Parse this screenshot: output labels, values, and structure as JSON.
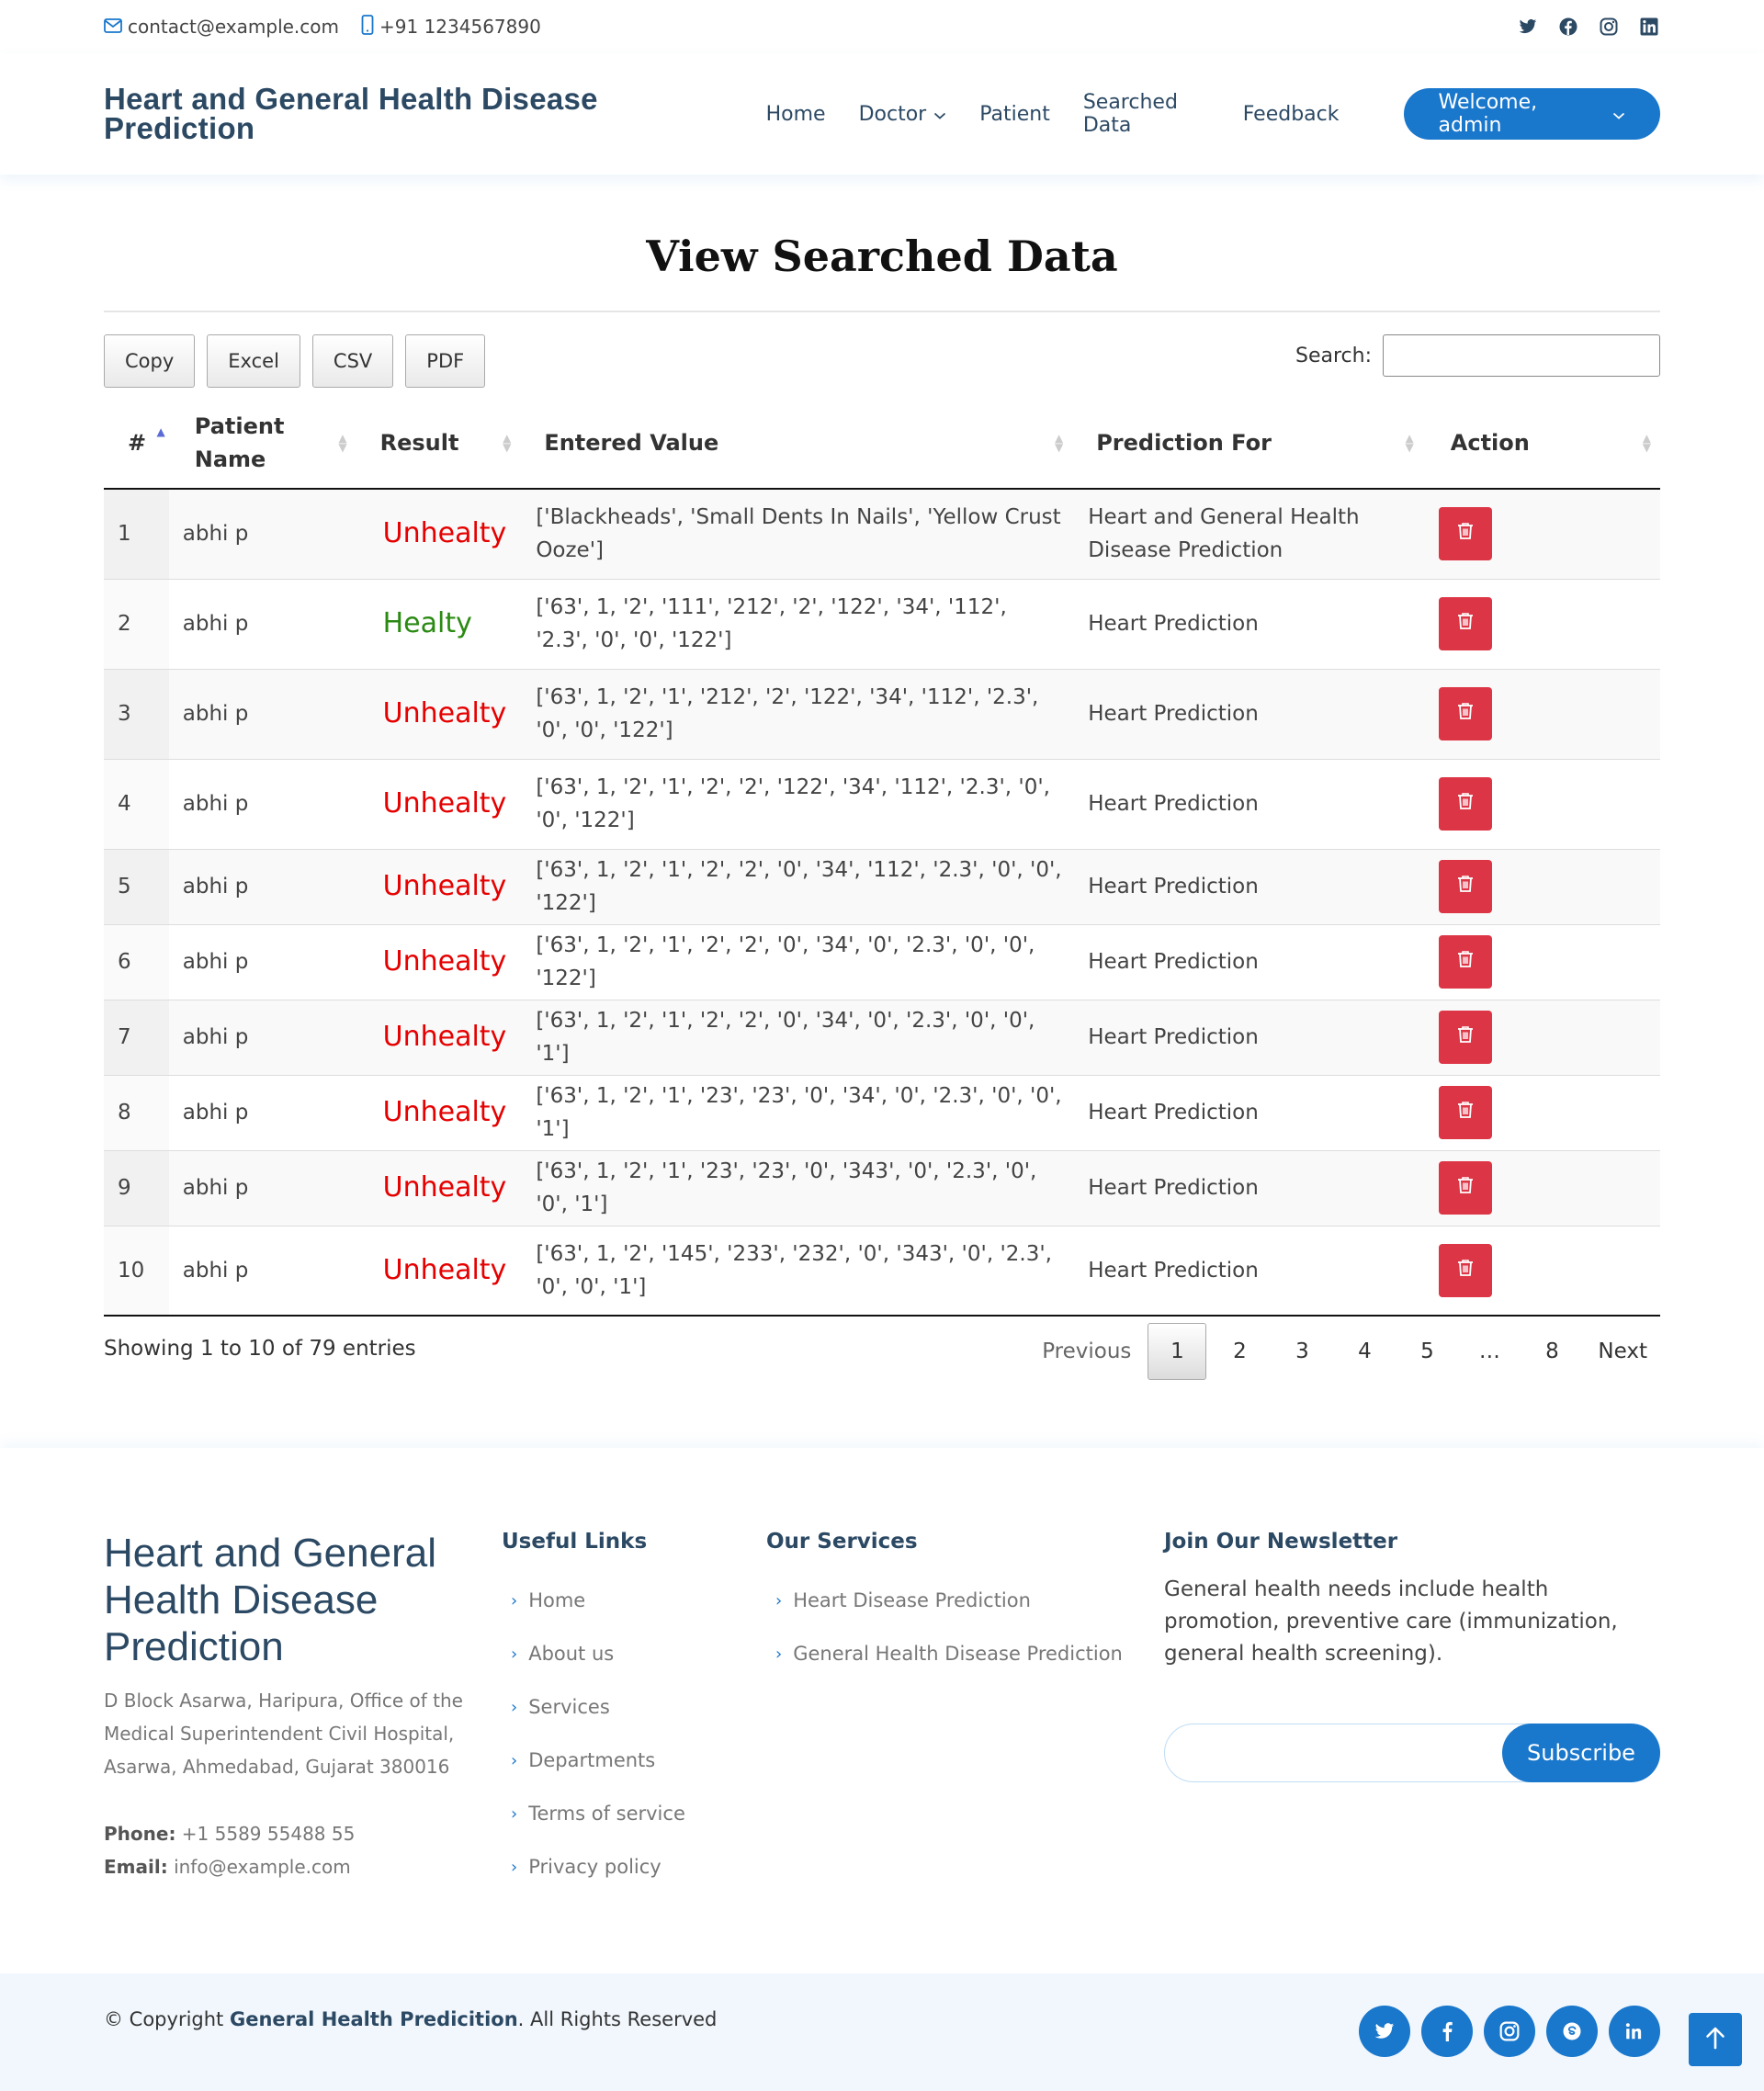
{
  "topbar": {
    "email": "contact@example.com",
    "phone": "+91 1234567890",
    "socials": [
      "twitter-icon",
      "facebook-icon",
      "instagram-icon",
      "linkedin-icon"
    ]
  },
  "header": {
    "logo": "Heart and General Health Disease Prediction",
    "nav": {
      "home": "Home",
      "doctor": "Doctor",
      "patient": "Patient",
      "searched": "Searched Data",
      "feedback": "Feedback"
    },
    "welcome": "Welcome, admin"
  },
  "main": {
    "title": "View Searched Data",
    "buttons": {
      "copy": "Copy",
      "excel": "Excel",
      "csv": "CSV",
      "pdf": "PDF"
    },
    "search_label": "Search:",
    "columns": {
      "index": "#",
      "patient_name": "Patient Name",
      "result": "Result",
      "entered_value": "Entered Value",
      "prediction_for": "Prediction For",
      "action": "Action"
    },
    "rows": [
      {
        "idx": "1",
        "name": "abhi p",
        "result": "Unhealty",
        "value": "['Blackheads', 'Small Dents In Nails', 'Yellow Crust Ooze']",
        "prediction": "Heart and General Health Disease Prediction"
      },
      {
        "idx": "2",
        "name": "abhi p",
        "result": "Healty",
        "value": "['63', 1, '2', '111', '212', '2', '122', '34', '112', '2.3', '0', '0', '122']",
        "prediction": "Heart Prediction"
      },
      {
        "idx": "3",
        "name": "abhi p",
        "result": "Unhealty",
        "value": "['63', 1, '2', '1', '212', '2', '122', '34', '112', '2.3', '0', '0', '122']",
        "prediction": "Heart Prediction"
      },
      {
        "idx": "4",
        "name": "abhi p",
        "result": "Unhealty",
        "value": "['63', 1, '2', '1', '2', '2', '122', '34', '112', '2.3', '0', '0', '122']",
        "prediction": "Heart Prediction"
      },
      {
        "idx": "5",
        "name": "abhi p",
        "result": "Unhealty",
        "value": "['63', 1, '2', '1', '2', '2', '0', '34', '112', '2.3', '0', '0', '122']",
        "prediction": "Heart Prediction"
      },
      {
        "idx": "6",
        "name": "abhi p",
        "result": "Unhealty",
        "value": "['63', 1, '2', '1', '2', '2', '0', '34', '0', '2.3', '0', '0', '122']",
        "prediction": "Heart Prediction"
      },
      {
        "idx": "7",
        "name": "abhi p",
        "result": "Unhealty",
        "value": "['63', 1, '2', '1', '2', '2', '0', '34', '0', '2.3', '0', '0', '1']",
        "prediction": "Heart Prediction"
      },
      {
        "idx": "8",
        "name": "abhi p",
        "result": "Unhealty",
        "value": "['63', 1, '2', '1', '23', '23', '0', '34', '0', '2.3', '0', '0', '1']",
        "prediction": "Heart Prediction"
      },
      {
        "idx": "9",
        "name": "abhi p",
        "result": "Unhealty",
        "value": "['63', 1, '2', '1', '23', '23', '0', '343', '0', '2.3', '0', '0', '1']",
        "prediction": "Heart Prediction"
      },
      {
        "idx": "10",
        "name": "abhi p",
        "result": "Unhealty",
        "value": "['63', 1, '2', '145', '233', '232', '0', '343', '0', '2.3', '0', '0', '1']",
        "prediction": "Heart Prediction"
      }
    ],
    "info": "Showing 1 to 10 of 79 entries",
    "pager": {
      "prev": "Previous",
      "p1": "1",
      "p2": "2",
      "p3": "3",
      "p4": "4",
      "p5": "5",
      "ellipsis": "…",
      "p8": "8",
      "next": "Next"
    }
  },
  "footer": {
    "brand": "Heart and General Health Disease Prediction",
    "address": "D Block Asarwa, Haripura, Office of the Medical Superintendent Civil Hospital, Asarwa, Ahmedabad, Gujarat 380016",
    "phone_label": "Phone:",
    "phone": "+1 5589 55488 55",
    "email_label": "Email:",
    "email": "info@example.com",
    "useful_title": "Useful Links",
    "useful_links": [
      "Home",
      "About us",
      "Services",
      "Departments",
      "Terms of service",
      "Privacy policy"
    ],
    "services_title": "Our Services",
    "services": [
      "Heart Disease Prediction",
      "General Health Disease Prediction"
    ],
    "newsletter_title": "Join Our Newsletter",
    "newsletter_text": "General health needs include health promotion, preventive care (immunization, general health screening).",
    "subscribe": "Subscribe",
    "copyright_prefix": "© Copyright",
    "copyright_name": "General Health Predicition",
    "copyright_suffix": ". All Rights Reserved",
    "socials": [
      "twitter-icon",
      "facebook-icon",
      "instagram-icon",
      "skype-icon",
      "linkedin-icon"
    ]
  },
  "colors": {
    "accent": "#1977cc",
    "navy": "#2c4964",
    "danger": "#dc3545",
    "unhealthy": "#e60000",
    "healthy": "#2a8a12"
  }
}
